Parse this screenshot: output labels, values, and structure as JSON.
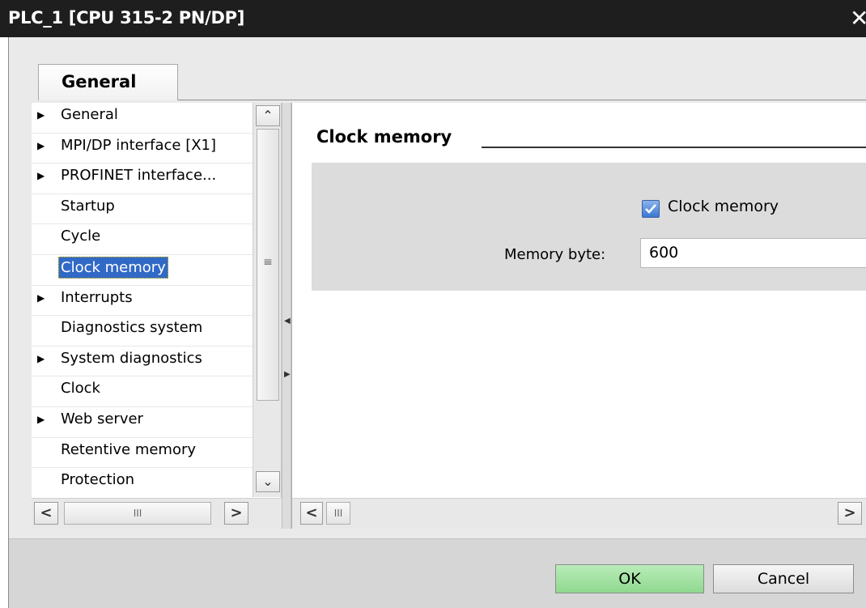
{
  "window": {
    "title": "PLC_1 [CPU 315-2 PN/DP]",
    "close_glyph": "✕"
  },
  "tabs": [
    {
      "label": "General",
      "active": true
    }
  ],
  "nav": {
    "items": [
      {
        "label": "General",
        "expandable": true
      },
      {
        "label": "MPI/DP interface [X1]",
        "expandable": true
      },
      {
        "label": "PROFINET interface...",
        "expandable": true
      },
      {
        "label": "Startup",
        "expandable": false
      },
      {
        "label": "Cycle",
        "expandable": false
      },
      {
        "label": "Clock memory",
        "expandable": false,
        "selected": true
      },
      {
        "label": "Interrupts",
        "expandable": true
      },
      {
        "label": "Diagnostics system",
        "expandable": false
      },
      {
        "label": "System diagnostics",
        "expandable": true
      },
      {
        "label": "Clock",
        "expandable": false
      },
      {
        "label": "Web server",
        "expandable": true
      },
      {
        "label": "Retentive memory",
        "expandable": false
      },
      {
        "label": "Protection",
        "expandable": false
      }
    ],
    "arrow_glyph": "▶"
  },
  "scroll_glyphs": {
    "up": "⌃",
    "down": "⌄",
    "left": "<",
    "right": ">",
    "grip_h": "III",
    "grip_v": "≡"
  },
  "content": {
    "section_title": "Clock memory",
    "checkbox_label": "Clock memory",
    "checkbox_checked": true,
    "memory_byte_label": "Memory byte:",
    "memory_byte_value": "600"
  },
  "buttons": {
    "ok_label": "OK",
    "cancel_label": "Cancel"
  },
  "colors": {
    "title_bar": "#1e1e1e",
    "selection": "#3169c6",
    "ok_button": "#a6e3a6"
  }
}
